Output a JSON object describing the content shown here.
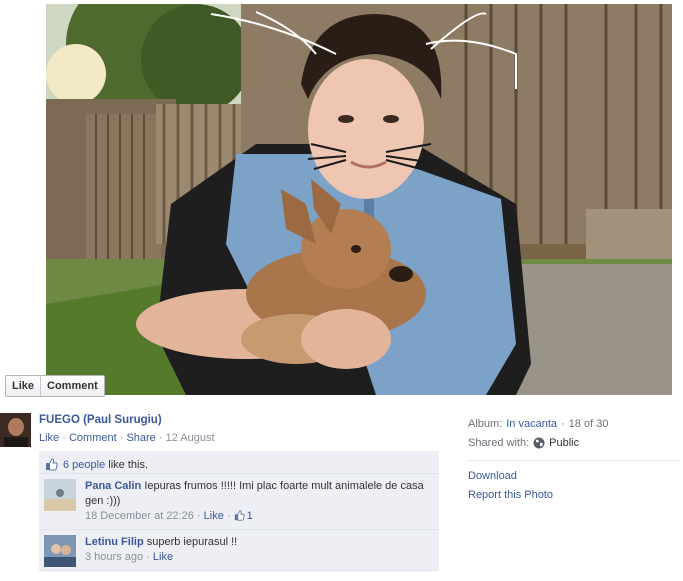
{
  "photo_actions": {
    "like_label": "Like",
    "comment_label": "Comment"
  },
  "post": {
    "author": "FUEGO (Paul Surugiu)",
    "like_link": "Like",
    "comment_link": "Comment",
    "share_link": "Share",
    "date": "12 August"
  },
  "likes": {
    "people_link": "6 people",
    "suffix": "like this."
  },
  "comments": [
    {
      "author": "Pana Calin",
      "text": "Iepuras frumos !!!!! Imi plac foarte mult animalele de casa gen :)))",
      "time": "18 December at 22:26",
      "like_link": "Like",
      "like_count": "1"
    },
    {
      "author": "Letinu Filip",
      "text": "superb iepurasul !!",
      "time": "3 hours ago",
      "like_link": "Like"
    }
  ],
  "sidebar": {
    "album_label": "Album:",
    "album_name": "In vacanta",
    "album_position": "18 of 30",
    "shared_label": "Shared with:",
    "shared_value": "Public",
    "download": "Download",
    "report": "Report this Photo"
  },
  "colors": {
    "link": "#3b5998",
    "feedback_bg": "#edeff4",
    "meta_gray": "#8b8f97"
  },
  "icons": [
    "thumbs-up-icon",
    "globe-icon"
  ]
}
